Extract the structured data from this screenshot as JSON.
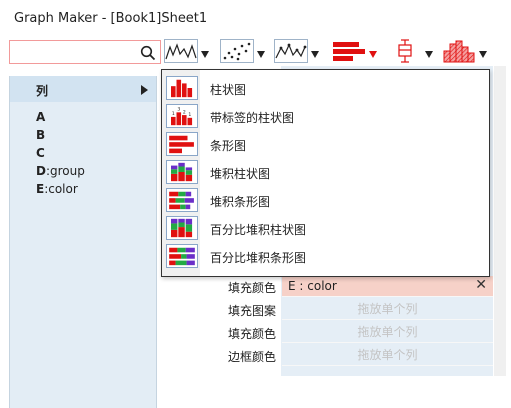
{
  "window": {
    "title": "Graph Maker - [Book1]Sheet1"
  },
  "search": {
    "value": "",
    "placeholder": ""
  },
  "columns": {
    "header": "列",
    "items": [
      {
        "key": "A",
        "desc": ""
      },
      {
        "key": "B",
        "desc": ""
      },
      {
        "key": "C",
        "desc": ""
      },
      {
        "key": "D",
        "desc": ":group"
      },
      {
        "key": "E",
        "desc": ":color"
      }
    ]
  },
  "toolbar": {
    "buttons": [
      "line-chart-icon",
      "scatter-chart-icon",
      "line-symbol-chart-icon",
      "bar-chart-icon",
      "box-chart-icon",
      "histogram-chart-icon"
    ],
    "active_color": "#e01010"
  },
  "menu": {
    "items": [
      "柱状图",
      "带标签的柱状图",
      "条形图",
      "堆积柱状图",
      "堆积条形图",
      "百分比堆积柱状图",
      "百分比堆积条形图"
    ]
  },
  "properties": [
    {
      "label": "填充颜色",
      "value": "E : color",
      "filled": true
    },
    {
      "label": "填充图案",
      "value": "拖放单个列",
      "filled": false
    },
    {
      "label": "填充颜色",
      "value": "拖放单个列",
      "filled": false
    },
    {
      "label": "边框颜色",
      "value": "拖放单个列",
      "filled": false
    }
  ]
}
